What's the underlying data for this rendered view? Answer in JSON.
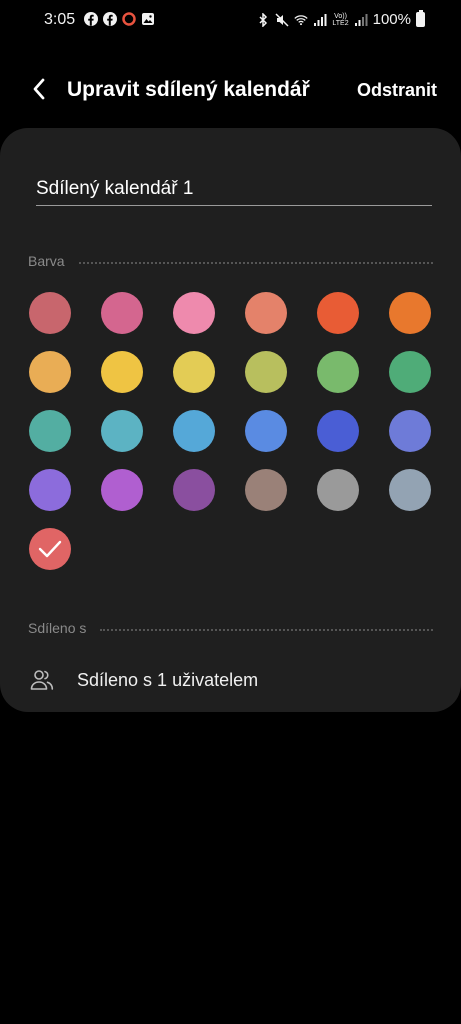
{
  "status_bar": {
    "time": "3:05",
    "volte_label": "Vo))\nLTE2",
    "battery_percent": "100%",
    "left_icons": [
      "facebook-icon",
      "facebook-icon",
      "record-ring-icon",
      "gallery-icon"
    ],
    "right_icons": [
      "bluetooth-icon",
      "mute-icon",
      "wifi-icon",
      "signal-icon",
      "volte-icon",
      "signal-icon",
      "battery-icon"
    ]
  },
  "header": {
    "back_icon": "back-arrow-icon",
    "title": "Upravit sdílený kalendář",
    "delete_label": "Odstranit"
  },
  "form": {
    "calendar_name": "Sdílený kalendář 1",
    "color_section_label": "Barva",
    "shared_section_label": "Sdíleno s",
    "shared_with_text": "Sdíleno s 1 uživatelem",
    "shared_icon": "people-icon",
    "selected_color_index": 24,
    "colors": [
      "#c8666d",
      "#d4668f",
      "#ee8aad",
      "#e4826a",
      "#e85c35",
      "#e8782d",
      "#e9ad55",
      "#efc443",
      "#e3cc55",
      "#b8bf5e",
      "#79ba6c",
      "#4fac78",
      "#53aea2",
      "#5cb3c3",
      "#55a8d8",
      "#5a8be2",
      "#4a5ed5",
      "#6e7bd8",
      "#8c6cdc",
      "#b05fd0",
      "#8a4f9f",
      "#9a8178",
      "#9a9a9a",
      "#93a3b3",
      "#e06565"
    ]
  }
}
